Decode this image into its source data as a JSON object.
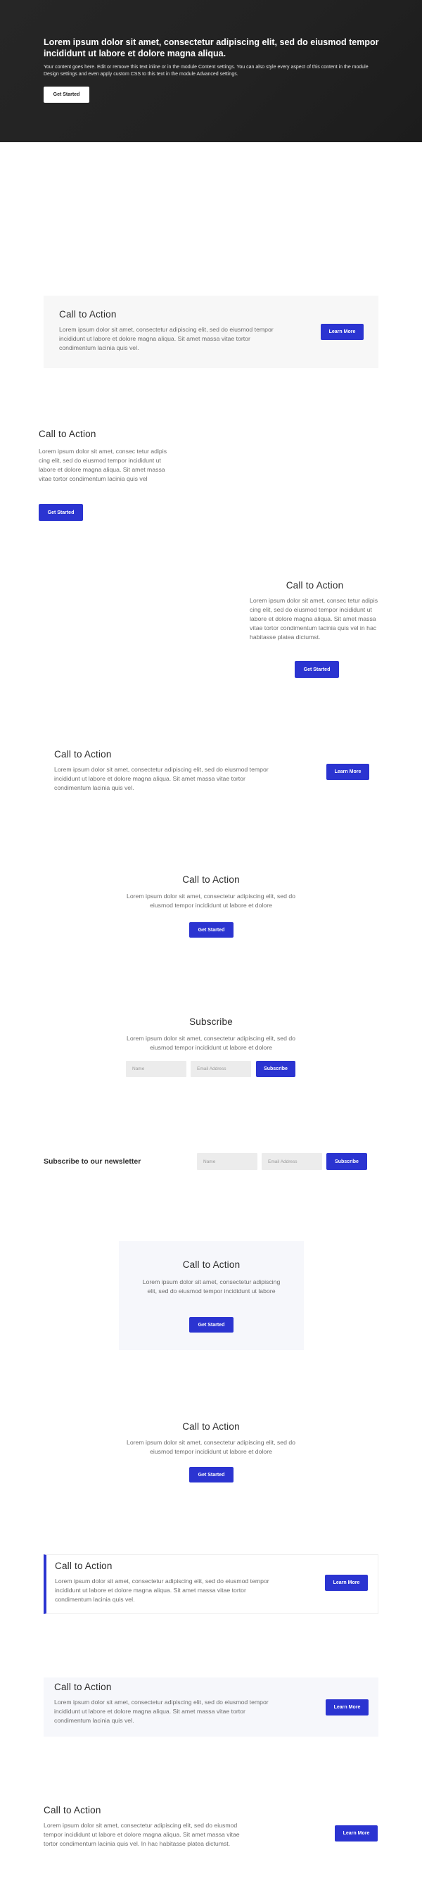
{
  "hero": {
    "title": "Lorem ipsum dolor sit amet, consectetur adipiscing elit, sed do eiusmod tempor incididunt ut labore et dolore magna aliqua.",
    "text": "Your content goes here. Edit or remove this text inline or in the module Content settings. You can also style every aspect of this content in the module Design settings and even apply custom CSS to this text in the module Advanced settings.",
    "button": "Get Started"
  },
  "cta1": {
    "title": "Call to Action",
    "text": "Lorem ipsum dolor sit amet, consectetur adipiscing elit, sed do eiusmod tempor incididunt ut labore et dolore magna aliqua. Sit amet massa vitae tortor condimentum lacinia quis vel.",
    "button": "Learn More"
  },
  "cta2": {
    "title": "Call to Action",
    "text": "Lorem ipsum dolor sit amet, consec tetur adipis cing elit, sed do eiusmod tempor incididunt ut labore et dolore magna aliqua. Sit amet massa vitae tortor condimentum lacinia quis vel",
    "button": "Get Started"
  },
  "cta3": {
    "title": "Call to Action",
    "text": "Lorem ipsum dolor sit amet, consec tetur adipis cing elit, sed do eiusmod tempor incididunt ut labore et dolore magna aliqua. Sit amet massa vitae tortor condimentum lacinia quis vel in hac habitasse platea dictumst.",
    "button": "Get Started"
  },
  "cta4": {
    "title": "Call to Action",
    "text": "Lorem ipsum dolor sit amet, consectetur adipiscing elit, sed do eiusmod tempor incididunt ut labore et dolore magna aliqua. Sit amet massa vitae tortor condimentum lacinia quis vel.",
    "button": "Learn More"
  },
  "cta5": {
    "title": "Call to Action",
    "text": "Lorem ipsum dolor sit amet, consectetur adipiscing elit, sed do eiusmod tempor incididunt ut labore et dolore",
    "button": "Get Started"
  },
  "subscribe": {
    "title": "Subscribe",
    "text": "Lorem ipsum dolor sit amet, consectetur adipiscing elit, sed do eiusmod tempor incididunt ut labore et dolore",
    "name_placeholder": "Name",
    "email_placeholder": "Email Address",
    "button": "Subscribe"
  },
  "newsletter": {
    "title": "Subscribe to our newsletter",
    "name_placeholder": "Name",
    "email_placeholder": "Email Address",
    "button": "Subscribe"
  },
  "cta6": {
    "title": "Call to Action",
    "text": "Lorem ipsum dolor sit amet, consectetur adipiscing elit, sed do eiusmod tempor incididunt ut labore",
    "button": "Get Started"
  },
  "cta7": {
    "title": "Call to Action",
    "text": "Lorem ipsum dolor sit amet, consectetur adipiscing elit, sed do eiusmod tempor incididunt ut labore et dolore",
    "button": "Get Started"
  },
  "cta8": {
    "title": "Call to Action",
    "text": "Lorem ipsum dolor sit amet, consectetur adipiscing elit, sed do eiusmod tempor incididunt ut labore et dolore magna aliqua. Sit amet massa vitae tortor condimentum lacinia quis vel.",
    "button": "Learn More"
  },
  "cta9": {
    "title": "Call to Action",
    "text": "Lorem ipsum dolor sit amet, consectetur adipiscing elit, sed do eiusmod tempor incididunt ut labore et dolore magna aliqua. Sit amet massa vitae tortor condimentum lacinia quis vel.",
    "button": "Learn More"
  },
  "cta10": {
    "title": "Call to Action",
    "text": "Lorem ipsum dolor sit amet, consectetur adipiscing elit, sed do eiusmod tempor incididunt ut labore et dolore magna aliqua. Sit amet massa vitae tortor condimentum lacinia quis vel. In hac habitasse platea dictumst.",
    "button": "Learn More"
  },
  "colors": {
    "accent": "#2b34d1",
    "hero_bg": "#222222",
    "light_bg": "#f7f7f7",
    "lavender_bg": "#f6f7fb"
  }
}
